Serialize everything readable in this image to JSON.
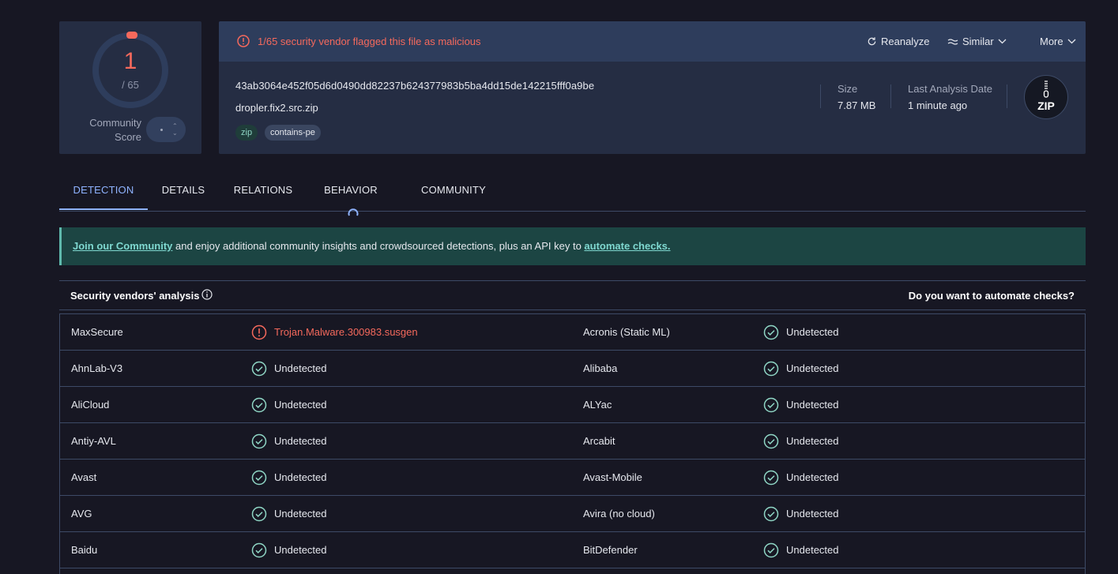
{
  "score": {
    "detections": "1",
    "total": "/ 65",
    "community_label_line1": "Community",
    "community_label_line2": "Score"
  },
  "header": {
    "alert": "1/65 security vendor flagged this file as malicious",
    "reanalyze": "Reanalyze",
    "similar": "Similar",
    "more": "More"
  },
  "file": {
    "sha256": "43ab3064e452f05d6d0490dd82237b624377983b5ba4dd15de142215fff0a9be",
    "name": "dropler.fix2.src.zip",
    "tags": [
      "zip",
      "contains-pe"
    ],
    "size_label": "Size",
    "size_value": "7.87 MB",
    "date_label": "Last Analysis Date",
    "date_value": "1 minute ago",
    "type_badge": "ZIP"
  },
  "tabs": [
    "DETECTION",
    "DETAILS",
    "RELATIONS",
    "BEHAVIOR",
    "COMMUNITY"
  ],
  "banner": {
    "link1": "Join our Community",
    "middle": " and enjoy additional community insights and crowdsourced detections, plus an API key to ",
    "link2": "automate checks."
  },
  "vendors_header": {
    "title": "Security vendors' analysis",
    "right": "Do you want to automate checks?"
  },
  "vendors": [
    {
      "left_name": "MaxSecure",
      "left_result": "Trojan.Malware.300983.susgen",
      "left_status": "malicious",
      "right_name": "Acronis (Static ML)",
      "right_result": "Undetected",
      "right_status": "clean"
    },
    {
      "left_name": "AhnLab-V3",
      "left_result": "Undetected",
      "left_status": "clean",
      "right_name": "Alibaba",
      "right_result": "Undetected",
      "right_status": "clean"
    },
    {
      "left_name": "AliCloud",
      "left_result": "Undetected",
      "left_status": "clean",
      "right_name": "ALYac",
      "right_result": "Undetected",
      "right_status": "clean"
    },
    {
      "left_name": "Antiy-AVL",
      "left_result": "Undetected",
      "left_status": "clean",
      "right_name": "Arcabit",
      "right_result": "Undetected",
      "right_status": "clean"
    },
    {
      "left_name": "Avast",
      "left_result": "Undetected",
      "left_status": "clean",
      "right_name": "Avast-Mobile",
      "right_result": "Undetected",
      "right_status": "clean"
    },
    {
      "left_name": "AVG",
      "left_result": "Undetected",
      "left_status": "clean",
      "right_name": "Avira (no cloud)",
      "right_result": "Undetected",
      "right_status": "clean"
    },
    {
      "left_name": "Baidu",
      "left_result": "Undetected",
      "left_status": "clean",
      "right_name": "BitDefender",
      "right_result": "Undetected",
      "right_status": "clean"
    }
  ],
  "colors": {
    "malicious": "#f5695c",
    "clean": "#8fd6c5",
    "accent": "#8fb3ff"
  }
}
